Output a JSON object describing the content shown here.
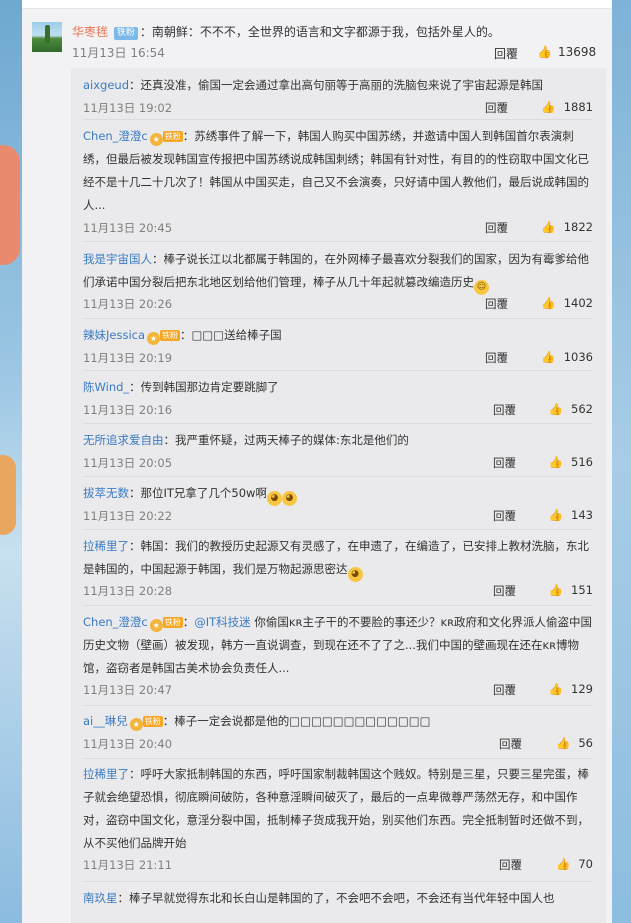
{
  "main": {
    "username": "华枣毪",
    "badge": "铁粉",
    "text": "：南朝鲜：不不不，全世界的语言和文字都源于我，包括外星人的。",
    "time": "11月13日 16:54",
    "reply_label": "回覆",
    "likes": "13698"
  },
  "replies": [
    {
      "name": "aixgeud",
      "text": "：还真没准，偷国一定会通过拿出高句丽等于高丽的洗脑包来说了宇宙起源是韩国",
      "time": "11月13日 19:02",
      "likes": "1881"
    },
    {
      "name": "Chen_澄澄c",
      "tag": "铁粉",
      "text": "：苏绣事件了解一下，韩国人购买中国苏绣，并邀请中国人到韩国首尔表演刺绣，但最后被发现韩国宣传报把中国苏绣说成韩国刺绣；韩国有针对性，有目的的性窃取中国文化已经不是十几二十几次了！韩国从中国买走，自己又不会演奏，只好请中国人教他们，最后说成韩国的人...",
      "time": "11月13日 20:45",
      "likes": "1822"
    },
    {
      "name": "我是宇宙国人",
      "text": "：棒子说长江以北都属于韩国的，在外网棒子最喜欢分裂我们的国家，因为有霉爹给他们承诺中国分裂后把东北地区划给他们管理，棒子从几十年起就篡改编造历史",
      "time": "11月13日 20:26",
      "likes": "1402"
    },
    {
      "name": "辣妹Jessica",
      "tag": "铁粉",
      "text": "：□□□送给棒子国",
      "time": "11月13日 20:19",
      "likes": "1036"
    },
    {
      "name": "陈Wind_",
      "text": "：传到韩国那边肯定要跳脚了",
      "time": "11月13日 20:16",
      "likes": "562"
    },
    {
      "name": "无所追求爱自由",
      "text": "：我严重怀疑，过两天棒子的媒体:东北是他们的",
      "time": "11月13日 20:05",
      "likes": "516"
    },
    {
      "name": "拔萃无数",
      "text": "：那位IT兄拿了几个50w啊",
      "time": "11月13日 20:22",
      "likes": "143"
    },
    {
      "name": "拉稀里了",
      "text": "：韩国：我们的教授历史起源又有灵感了，在申遗了，在编造了，已安排上教材洗脑，东北是韩国的，中国起源于韩国，我们是万物起源思密达",
      "time": "11月13日 20:28",
      "likes": "151"
    },
    {
      "name": "Chen_澄澄c",
      "tag": "铁粉",
      "at": "@IT科技迷",
      "text": "你偷国ᴋʀ主子干的不要脸的事还少？ᴋʀ政府和文化界派人偷盗中国历史文物（壁画）被发现，韩方一直说调查，到现在还不了了之...我们中国的壁画现在还在ᴋʀ博物馆，盗窃者是韩国古美术协会负责任人...",
      "time": "11月13日 20:47",
      "likes": "129"
    },
    {
      "name": "ai__琳兒",
      "tag": "铁粉",
      "text": "：棒子一定会说都是他的□□□□□□□□□□□□□",
      "time": "11月13日 20:40",
      "likes": "56"
    },
    {
      "name": "拉稀里了",
      "text": "：呼吁大家抵制韩国的东西，呼吁国家制裁韩国这个贱奴。特别是三星，只要三星完蛋，棒子就会绝望恐惧，彻底瞬间破防，各种意淫瞬间破灭了，最后的一点卑微尊严荡然无存，和中国作对，盗窃中国文化，意淫分裂中国，抵制棒子货成我开始，别买他们东西。完全抵制暂时还做不到，从不买他们品牌开始",
      "time": "11月13日 21:11",
      "likes": "70"
    },
    {
      "name": "南玖星",
      "text": "：棒子早就觉得东北和长白山是韩国的了，不会吧不会吧，不会还有当代年轻中国人也"
    }
  ],
  "reply_label": "回覆"
}
